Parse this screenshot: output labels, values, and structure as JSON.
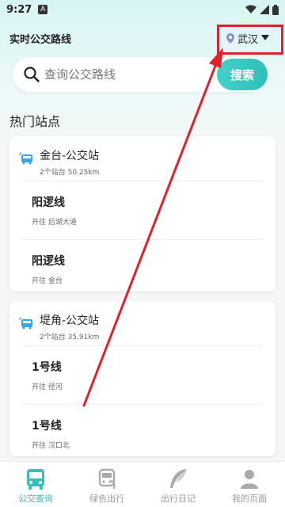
{
  "status_bar": {
    "time": "9:27",
    "notif": "A"
  },
  "header": {
    "title": "实时公交路线",
    "city": "武汉"
  },
  "search": {
    "placeholder": "查询公交路线",
    "button": "搜索"
  },
  "section_title": "热门站点",
  "stations": [
    {
      "name": "金台-公交站",
      "meta": "2个站台 50.25km",
      "routes": [
        {
          "name": "阳逻线",
          "dir": "开往 后湖大道"
        },
        {
          "name": "阳逻线",
          "dir": "开往 金台"
        }
      ]
    },
    {
      "name": "堤角-公交站",
      "meta": "2个站台 35.91km",
      "routes": [
        {
          "name": "1号线",
          "dir": "开往 径河"
        },
        {
          "name": "1号线",
          "dir": "开往 汉口北"
        }
      ]
    }
  ],
  "nav": [
    {
      "label": "公交查询",
      "icon": "bus-icon",
      "active": true
    },
    {
      "label": "绿色出行",
      "icon": "recycle-bus-icon",
      "active": false
    },
    {
      "label": "出行日记",
      "icon": "feather-icon",
      "active": false
    },
    {
      "label": "我的页面",
      "icon": "user-icon",
      "active": false
    }
  ],
  "colors": {
    "accent": "#31c2bb",
    "annotation": "#e0202a"
  }
}
